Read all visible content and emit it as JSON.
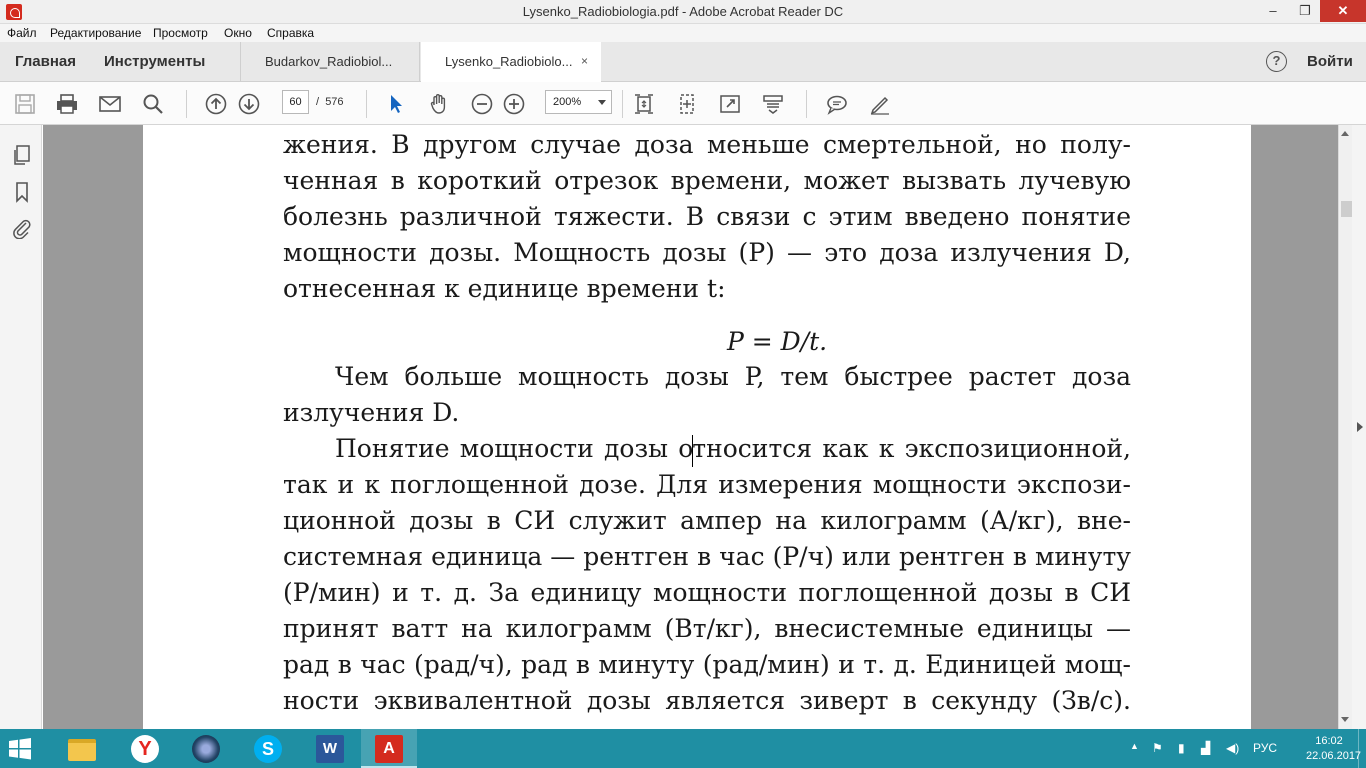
{
  "window": {
    "title": "Lysenko_Radiobiologia.pdf - Adobe Acrobat Reader DC",
    "minimize": "–",
    "maximize": "❐",
    "close": "✕"
  },
  "menu": [
    "Файл",
    "Редактирование",
    "Просмотр",
    "Окно",
    "Справка"
  ],
  "nav": {
    "home": "Главная",
    "tools": "Инструменты",
    "tabs": [
      {
        "label": "Budarkov_Radiobiol...",
        "active": false
      },
      {
        "label": "Lysenko_Radiobiolo...",
        "active": true,
        "close": "×"
      }
    ],
    "help": "?",
    "signin": "Войти"
  },
  "toolbar": {
    "page_current": "60",
    "page_separator": "/",
    "page_total": "576",
    "zoom": "200%",
    "icons": [
      "save-icon",
      "print-icon",
      "email-icon",
      "search-icon",
      "prev-page-icon",
      "next-page-icon",
      "select-icon",
      "hand-icon",
      "zoom-out-icon",
      "zoom-in-icon",
      "fit-page-icon",
      "scroll-mode-icon",
      "full-screen-icon",
      "read-mode-icon",
      "comment-icon",
      "sign-icon"
    ]
  },
  "left_panel": {
    "icons": [
      "pages-icon",
      "bookmark-icon",
      "attachment-icon"
    ]
  },
  "document": {
    "lines": [
      {
        "text": "жения. В другом случае доза меньше смертельной, но полу-",
        "indent": false,
        "last": false
      },
      {
        "text": "ченная в короткий отрезок времени, может вызвать лучевую",
        "indent": false,
        "last": false
      },
      {
        "text": "болезнь различной тяжести. В связи с этим введено понятие",
        "indent": false,
        "last": false
      },
      {
        "text": "мощности дозы. Мощность дозы (P) — это доза излучения D,",
        "indent": false,
        "last": false
      },
      {
        "text": "отнесенная к единице времени t:",
        "indent": false,
        "last": true
      }
    ],
    "formula": "P = D/t.",
    "lines2": [
      {
        "text": "Чем больше мощность дозы P, тем быстрее растет доза",
        "indent": true,
        "last": false
      },
      {
        "text": "излучения D.",
        "indent": false,
        "last": true
      }
    ],
    "para3_first_a": "Понятие мощности дозы о",
    "para3_first_b": "тносится как к экспозиционной,",
    "lines3": [
      {
        "text": "так и к поглощенной дозе. Для измерения мощности экспози-"
      },
      {
        "text": "ционной дозы в СИ служит ампер на килограмм (А/кг), вне-"
      },
      {
        "text": "системная единица — рентген в час (Р/ч) или рентген в минуту"
      },
      {
        "text": "(Р/мин) и т. д. За единицу мощности поглощенной дозы в СИ"
      },
      {
        "text": "принят ватт на килограмм (Вт/кг), внесистемные единицы —"
      },
      {
        "text": "рад в час (рад/ч), рад в минуту (рад/мин) и т. д. Единицей мощ-"
      },
      {
        "text": "ности эквивалентной дозы является зиверт в секунду (Зв/с)."
      }
    ]
  },
  "taskbar": {
    "apps": [
      "file-explorer-icon",
      "yandex-browser-icon",
      "media-app-icon",
      "skype-icon",
      "word-icon",
      "acrobat-reader-icon"
    ],
    "tray": {
      "language": "РУС",
      "time": "16:02",
      "date": "22.06.2017"
    }
  },
  "colors": {
    "taskbar": "#1f8fa3",
    "close_button": "#c7352b",
    "page_background": "#9a9a9a",
    "acrobat_red": "#d42b1e"
  }
}
